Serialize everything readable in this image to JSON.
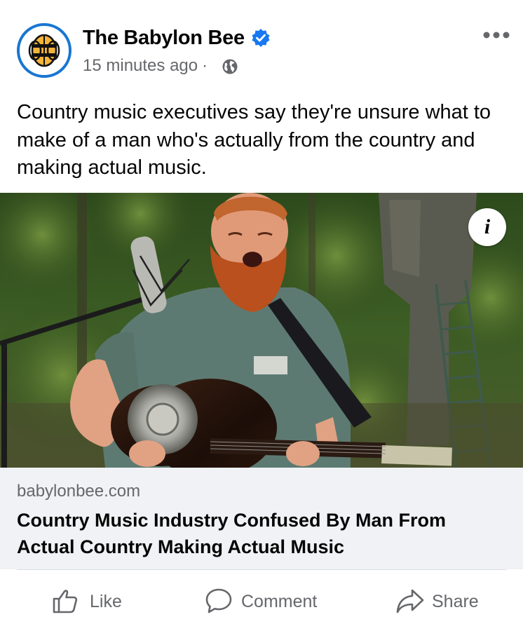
{
  "post": {
    "page_name": "The Babylon Bee",
    "timestamp": "15 minutes ago",
    "separator": "·",
    "caption": "Country music executives say they're unsure what to make of a man who's actually from the country and making actual music.",
    "verified": true,
    "audience_icon": "globe-icon",
    "menu_icon": "more-options-icon"
  },
  "link_preview": {
    "domain": "babylonbee.com",
    "title": "Country Music Industry Confused By Man From Actual Country Making Actual Music",
    "info_label": "i"
  },
  "actions": [
    {
      "label": "Like",
      "icon": "thumbs-up-icon"
    },
    {
      "label": "Comment",
      "icon": "comment-icon"
    },
    {
      "label": "Share",
      "icon": "share-icon"
    }
  ],
  "colors": {
    "verified_badge": "#1877f2",
    "avatar_ring": "#1876d2",
    "secondary_text": "#65676b",
    "link_preview_bg": "#f0f2f5"
  }
}
